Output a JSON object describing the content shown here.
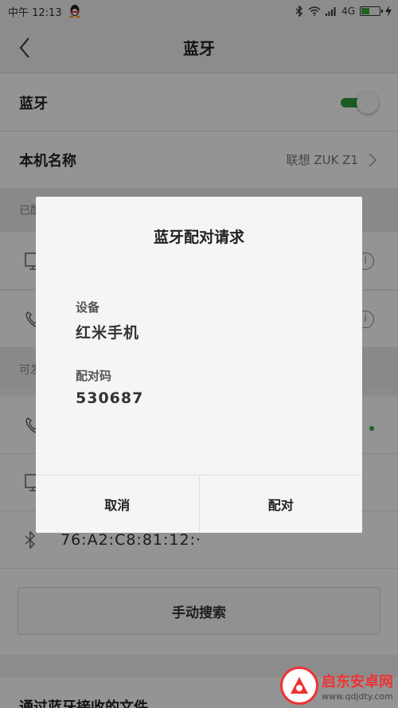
{
  "statusbar": {
    "time": "中午 12:13",
    "network": "4G"
  },
  "header": {
    "title": "蓝牙"
  },
  "settings": {
    "bluetooth_label": "蓝牙",
    "bluetooth_on": true,
    "device_name_label": "本机名称",
    "device_name_value": "联想 ZUK Z1"
  },
  "paired_header": "已配",
  "available_header": "可发",
  "devices": {
    "mac_fragment": "76:A2:C8:81:12:·"
  },
  "scan_button": "手动搜索",
  "received_files_label": "通过蓝牙接收的文件",
  "dialog": {
    "title": "蓝牙配对请求",
    "device_label": "设备",
    "device_value": "红米手机",
    "code_label": "配对码",
    "code_value": "530687",
    "cancel_label": "取消",
    "pair_label": "配对"
  },
  "watermark": {
    "brand": "启东安卓网",
    "url": "www.qdjdty.com"
  },
  "colors": {
    "accent_green": "#2f9d3f",
    "watermark_red": "#e33333"
  }
}
